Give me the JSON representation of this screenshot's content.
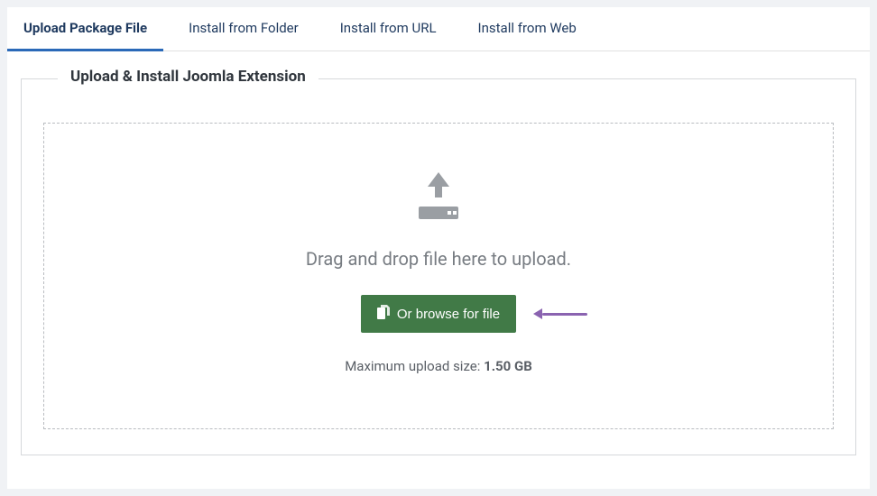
{
  "tabs": [
    {
      "label": "Upload Package File",
      "active": true
    },
    {
      "label": "Install from Folder",
      "active": false
    },
    {
      "label": "Install from URL",
      "active": false
    },
    {
      "label": "Install from Web",
      "active": false
    }
  ],
  "fieldset": {
    "legend": "Upload & Install Joomla Extension"
  },
  "dropzone": {
    "drag_text": "Drag and drop file here to upload.",
    "browse_button": "Or browse for file",
    "max_size_label": "Maximum upload size: ",
    "max_size_value": "1.50 GB"
  }
}
